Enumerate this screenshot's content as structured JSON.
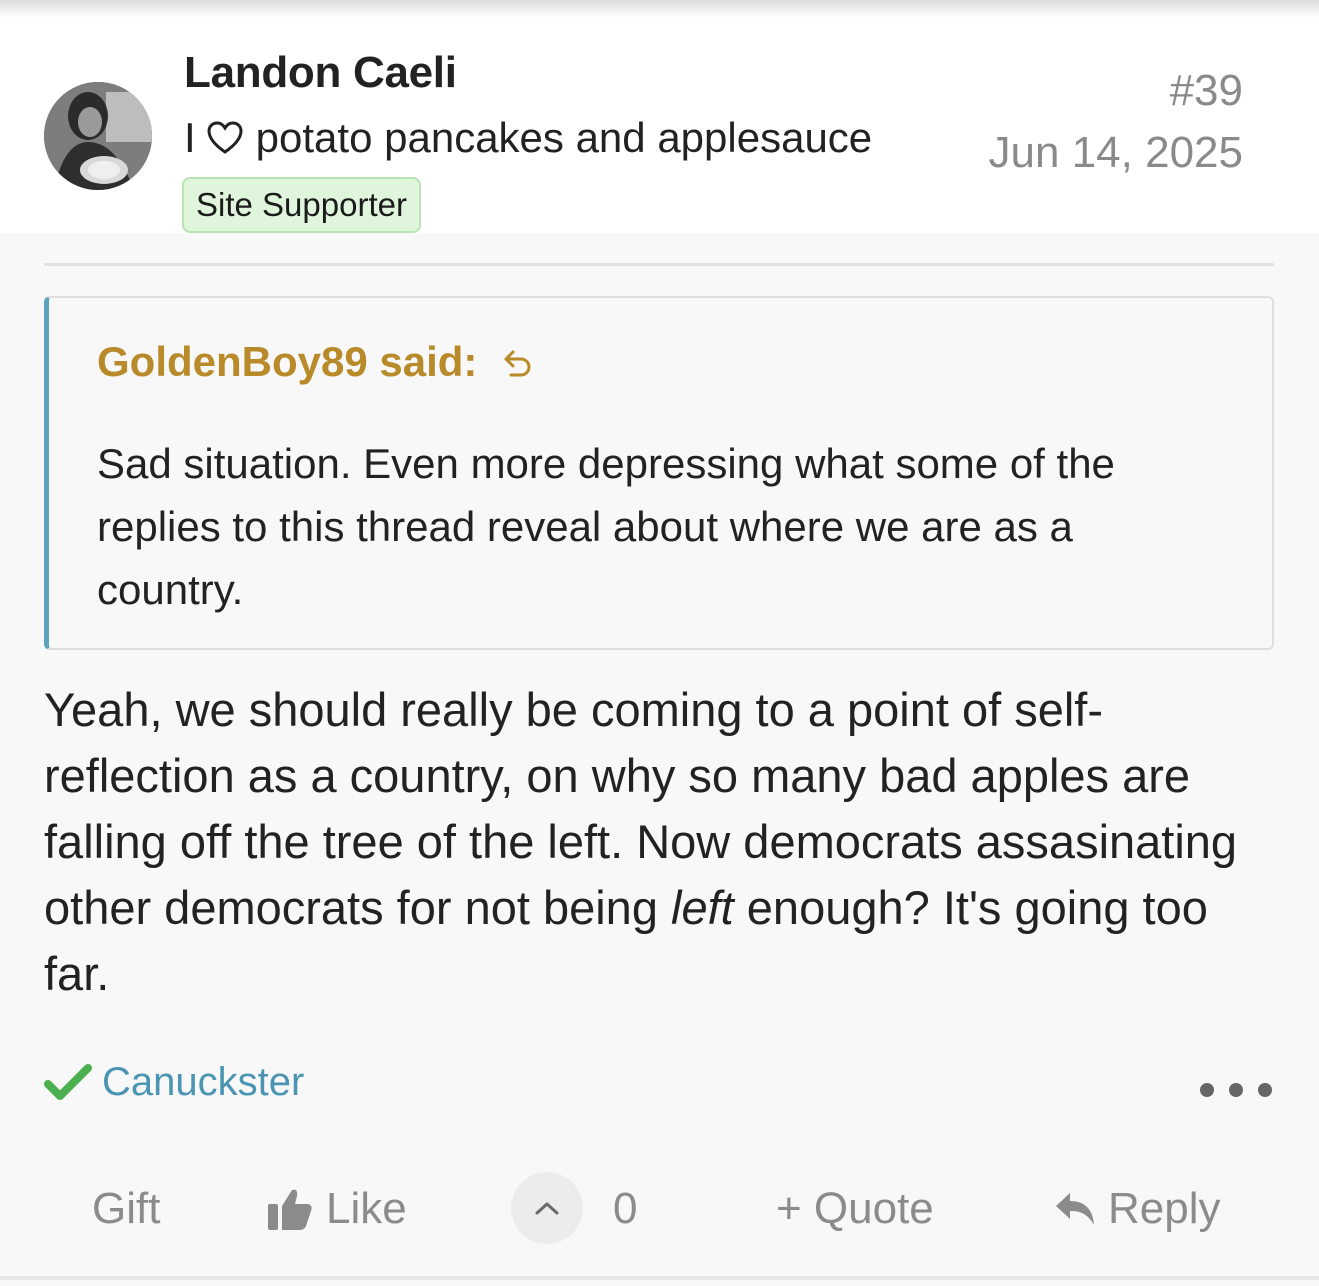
{
  "post": {
    "author": "Landon Caeli",
    "user_title": "potato pancakes and applesauce",
    "user_title_prefix": "I",
    "badge": "Site Supporter",
    "post_number": "#39",
    "date": "Jun 14, 2025"
  },
  "quote": {
    "header": "GoldenBoy89 said:",
    "text": "Sad situation. Even more depressing what some of the replies to this thread reveal about where we are as a country."
  },
  "body": {
    "text_before": "Yeah, we should really be coming to a point of self-reflection as a country, on why so many bad apples are falling off the tree of the left. Now democrats assasinating other democrats for not being ",
    "italic": "left",
    "text_after": " enough? It's going too far."
  },
  "reactions": {
    "icon": "checkmark-icon",
    "users": "Canuckster"
  },
  "actions": {
    "gift": "Gift",
    "like": "Like",
    "vote_count": "0",
    "quote": "+ Quote",
    "reply": "Reply"
  },
  "colors": {
    "quote_author": "#b88a2a",
    "quote_border": "#5fa2bd",
    "reaction_user": "#4b95b3",
    "badge_bg": "#dff6dc"
  }
}
